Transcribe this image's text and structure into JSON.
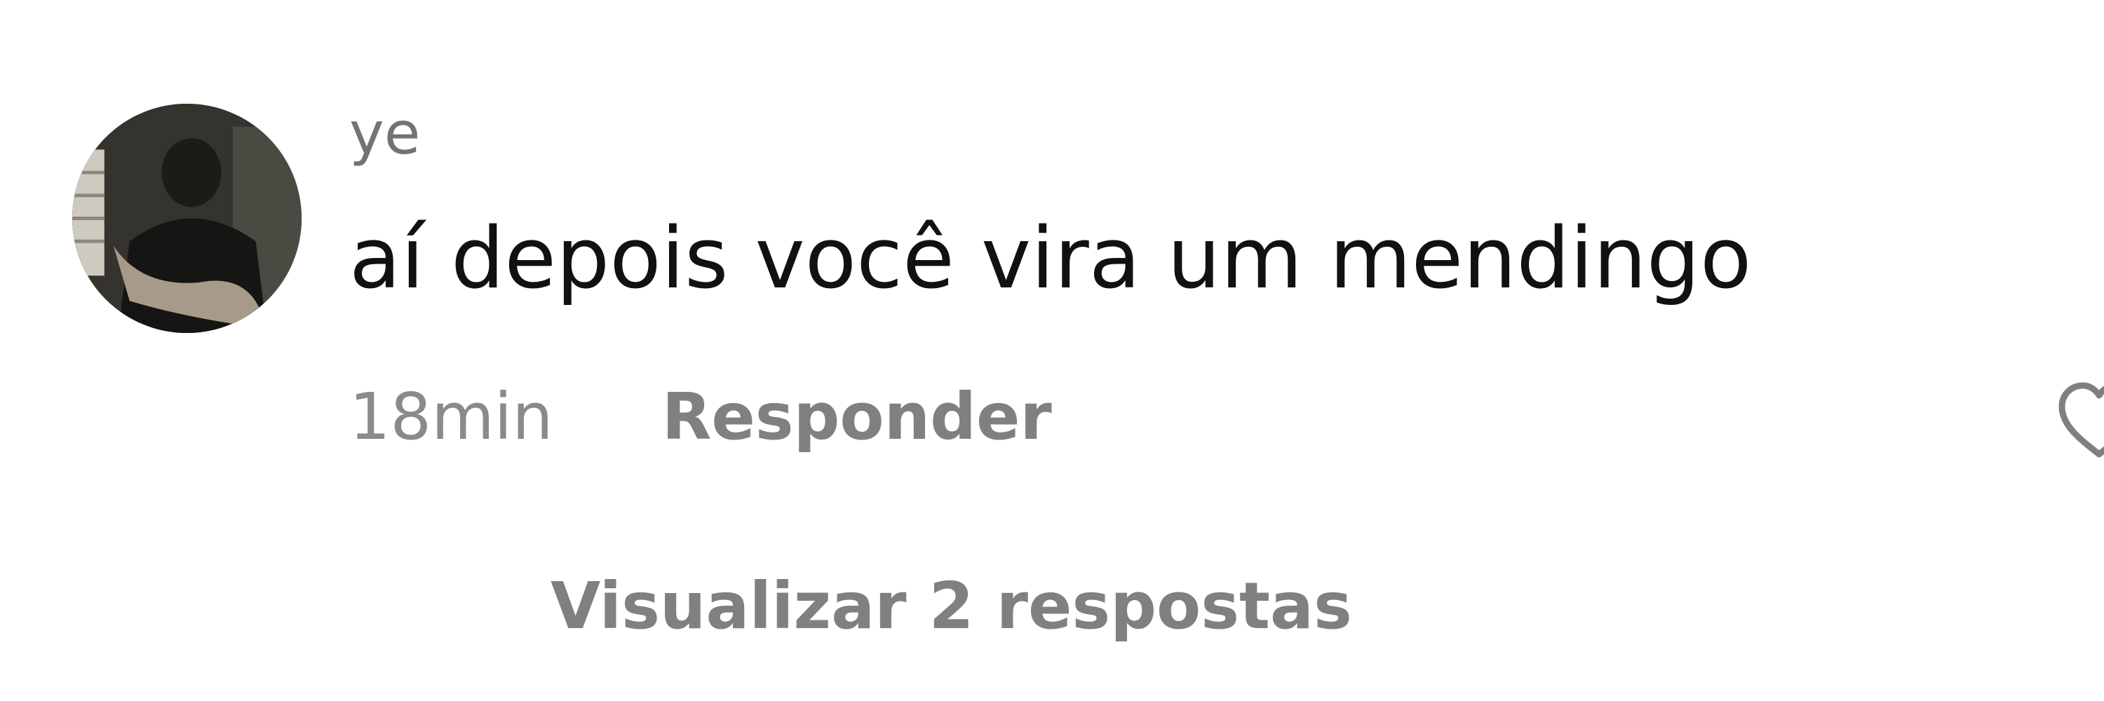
{
  "comment": {
    "username": "ye",
    "text": "aí depois você vira um mendingo",
    "timestamp": "18min",
    "reply_label": "Responder",
    "view_replies_label": "Visualizar 2 respostas"
  },
  "icons": {
    "like": "heart-icon"
  },
  "colors": {
    "text_primary": "#111111",
    "text_secondary": "#808080",
    "background": "#ffffff"
  }
}
